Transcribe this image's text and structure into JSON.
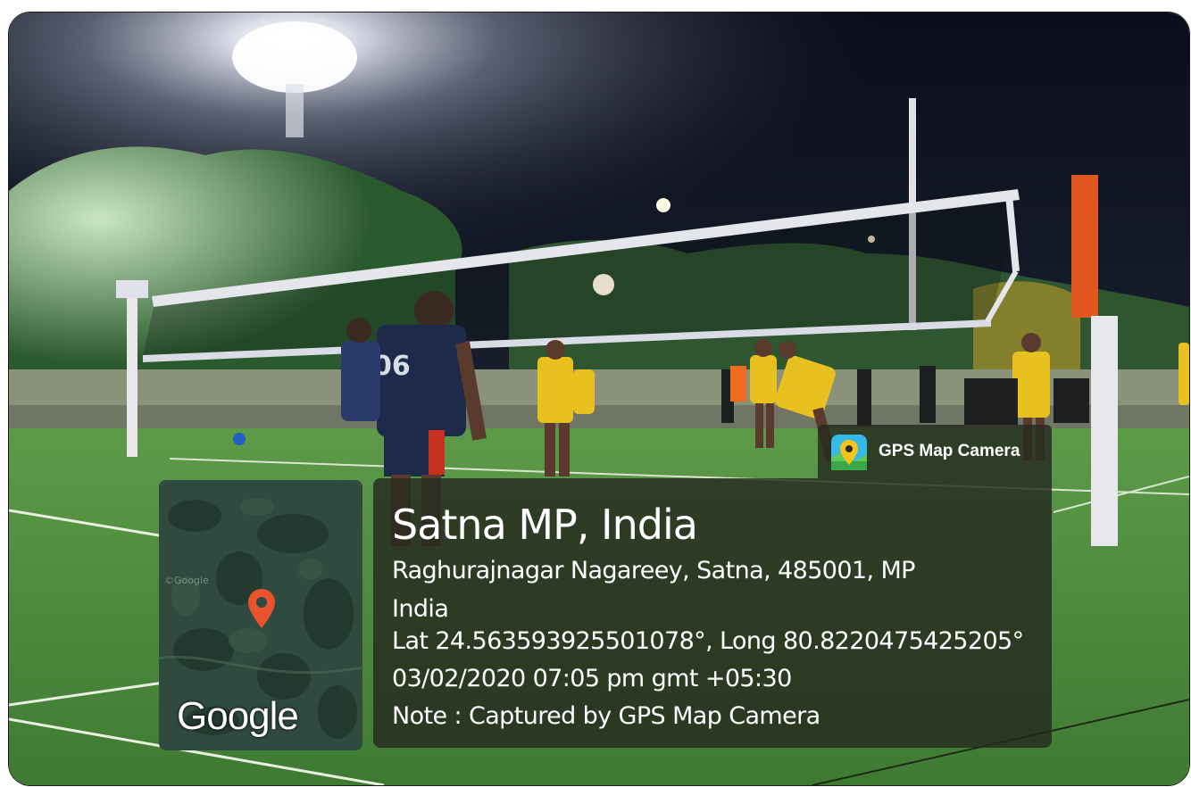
{
  "scene": {
    "jersey_number": "06"
  },
  "map": {
    "faint_label": "©Google",
    "logo_text": "Google",
    "pin_icon": "location-pin-icon"
  },
  "badge": {
    "app_name": "GPS Map Camera",
    "icon": "gps-map-camera-app-icon"
  },
  "info": {
    "title": "Satna MP, India",
    "address_line1": "Raghurajnagar Nagareey, Satna, 485001, MP",
    "address_line2": "India",
    "coords": "Lat 24.563593925501078°, Long 80.8220475425205°",
    "datetime": "03/02/2020 07:05 pm gmt +05:30",
    "note": "Note : Captured by GPS Map Camera"
  },
  "colors": {
    "panel_bg": "#262a20",
    "pin": "#e8532e",
    "jersey_yellow": "#e8c020",
    "jersey_navy": "#1e2a4a",
    "turf": "#4f8a3c",
    "net_pole": "#e0561e"
  }
}
